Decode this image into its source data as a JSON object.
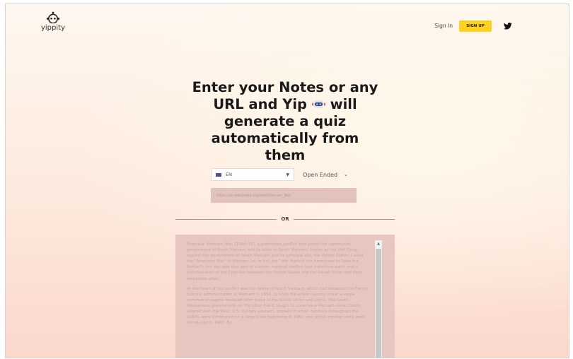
{
  "brand": {
    "name": "yippity"
  },
  "nav": {
    "sign_in": "Sign In",
    "sign_up": "SIGN UP"
  },
  "hero": {
    "line1": "Enter your Notes or any",
    "line2a": "URL and Yip",
    "line2b": "will",
    "line3": "generate a quiz",
    "line4": "automatically from",
    "line5": "them"
  },
  "form": {
    "language": "EN",
    "question_type": "Open Ended",
    "url_placeholder": "https://en.wikipedia.org/wiki/Vietnam_War",
    "divider_text": "OR",
    "notes_paragraphs": [
      "Example: Vietnam War, (1954–75), a protracted conflict that pitted the communist government of North Vietnam and its allies in South Vietnam, known as the Viet Cong, against the government of South Vietnam and its principal ally, the United States. Called the \"American War\" in Vietnam (or, in full, the \"War Against the Americans to Save the Nation\"), the war was also part of a larger regional conflict (see Indochina wars) and a manifestation of the Cold War between the United States and the Soviet Union and their respective allies.",
      "At the heart of the conflict was the desire of North Vietnam, which had defeated the French colonial administration of Vietnam in 1954, to unify the entire country under a single communist regime modeled after those of the Soviet Union and China. The South Vietnamese government, on the other hand, fought to preserve a Vietnam more closely aligned with the West. U.S. military advisers, present in small numbers throughout the 1950s, were introduced on a large scale beginning in 1961, and active combat units were introduced in 1965. By"
    ]
  },
  "colors": {
    "signup_bg": "#ffd21f",
    "input_bg": "#e2c2bd",
    "notes_bg": "#e8c6c0",
    "headline": "#1a1a1a"
  },
  "icons": {
    "logo": "robot-logo-icon",
    "twitter": "twitter-icon",
    "flag": "uk-flag-icon",
    "emoji": "robot-face-emoji"
  }
}
